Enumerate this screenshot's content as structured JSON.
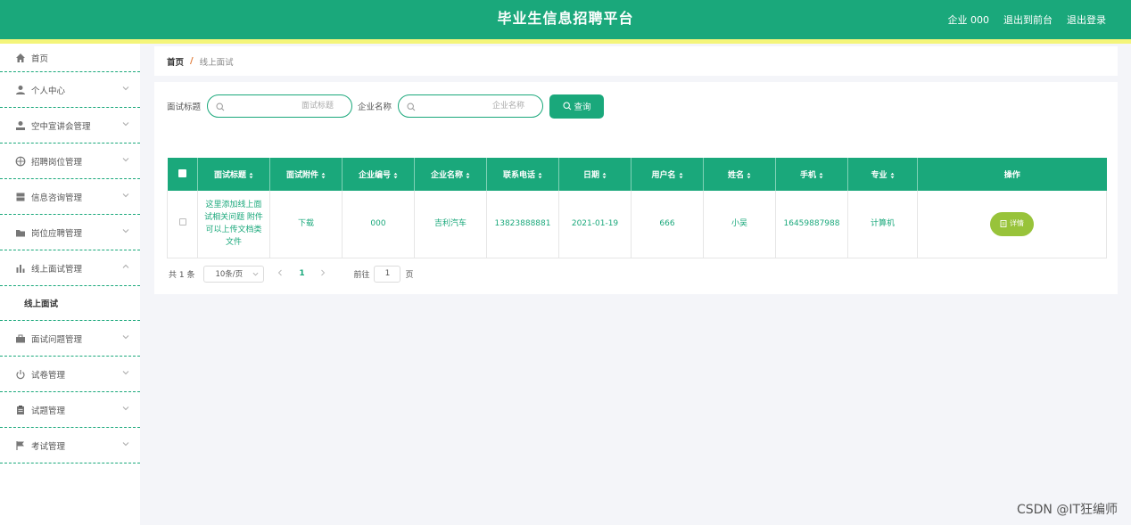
{
  "header": {
    "title": "毕业生信息招聘平台",
    "user_label": "企业 000",
    "front_link": "退出到前台",
    "logout_link": "退出登录"
  },
  "sidebar": {
    "items": [
      {
        "label": "首页",
        "icon": "home-icon"
      },
      {
        "label": "个人中心",
        "icon": "user-icon"
      },
      {
        "label": "空中宣讲会管理",
        "icon": "speaker-icon"
      },
      {
        "label": "招聘岗位管理",
        "icon": "compass-icon"
      },
      {
        "label": "信息咨询管理",
        "icon": "archive-icon"
      },
      {
        "label": "岗位应聘管理",
        "icon": "folder-icon"
      },
      {
        "label": "线上面试管理",
        "icon": "bar-chart-icon"
      },
      {
        "label": "面试问题管理",
        "icon": "briefcase-icon"
      },
      {
        "label": "试卷管理",
        "icon": "power-icon"
      },
      {
        "label": "试题管理",
        "icon": "clipboard-icon"
      },
      {
        "label": "考试管理",
        "icon": "flag-icon"
      }
    ],
    "sub_item": "线上面试"
  },
  "breadcrumb": {
    "home": "首页",
    "separator": "/",
    "current": "线上面试"
  },
  "search": {
    "title_label": "面试标题",
    "title_placeholder": "面试标题",
    "company_label": "企业名称",
    "company_placeholder": "企业名称",
    "query_button": "查询"
  },
  "table": {
    "columns": [
      "面试标题",
      "面试附件",
      "企业编号",
      "企业名称",
      "联系电话",
      "日期",
      "用户名",
      "姓名",
      "手机",
      "专业",
      "操作"
    ],
    "rows": [
      {
        "title": "这里添加线上面试相关问题 附件可以上传文档类文件",
        "attachment": "下载",
        "company_no": "000",
        "company_name": "吉利汽车",
        "phone": "13823888881",
        "date": "2021-01-19",
        "username": "666",
        "name": "小吴",
        "mobile": "16459887988",
        "major": "计算机",
        "action": "详情"
      }
    ]
  },
  "pagination": {
    "total": "共 1 条",
    "page_size": "10条/页",
    "current_page": "1",
    "goto_label": "前往",
    "goto_value": "1",
    "goto_suffix": "页"
  },
  "watermark": "CSDN @IT狂编师",
  "colors": {
    "primary": "#1aa87b",
    "stripe": "#f4f57a",
    "detail_button": "#98c33a"
  }
}
